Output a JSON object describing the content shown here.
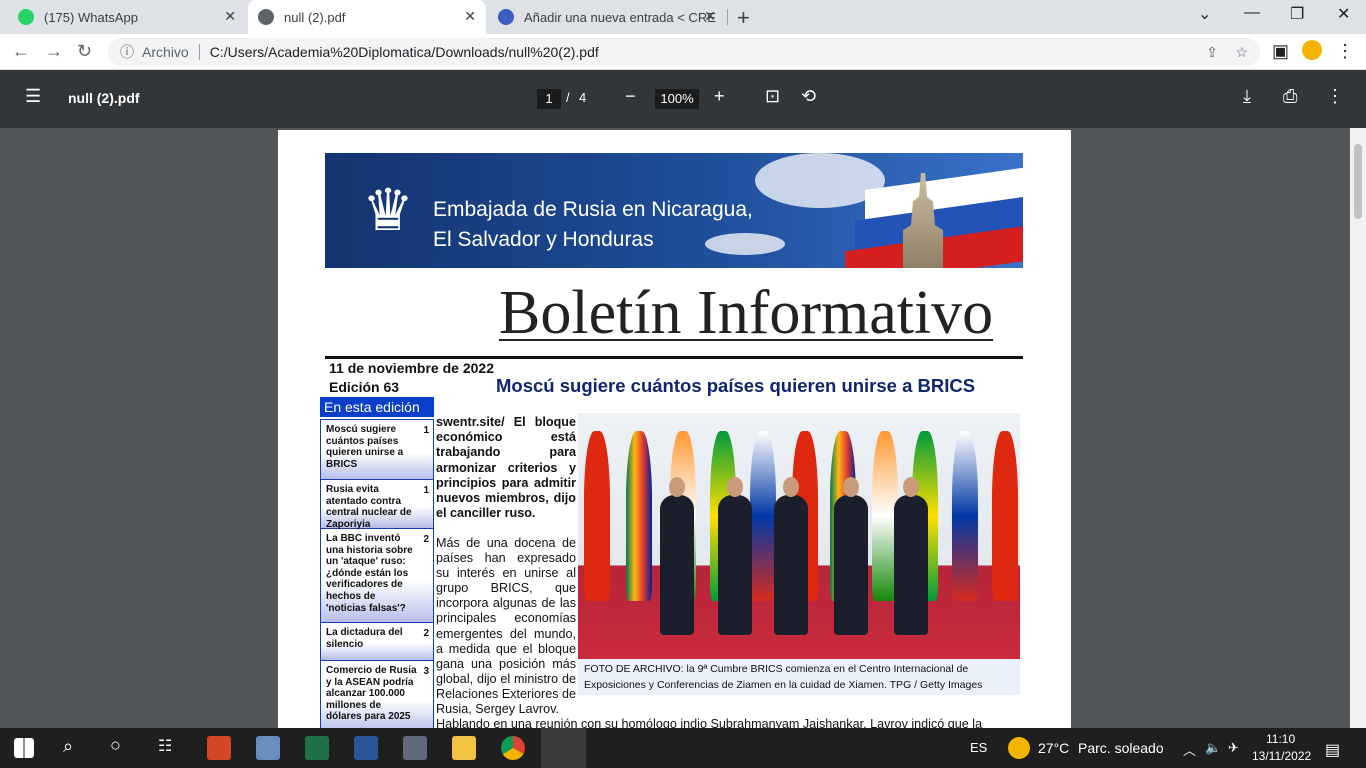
{
  "browser": {
    "tabs": [
      {
        "title": "(175) WhatsApp"
      },
      {
        "title": "null (2).pdf"
      },
      {
        "title": "Añadir una nueva entrada < CRE"
      }
    ],
    "address_chip": "Archivo",
    "url": "C:/Users/Academia%20Diplomatica/Downloads/null%20(2).pdf"
  },
  "viewer": {
    "filename": "null (2).pdf",
    "current_page": "1",
    "page_sep": "/",
    "total_pages": "4",
    "zoom": "100%"
  },
  "bulletin": {
    "banner_line1": "Embajada de Rusia en Nicaragua,",
    "banner_line2": "El Salvador y Honduras",
    "title": "Boletín Informativo",
    "date": "11 de noviembre de 2022",
    "edition": "Edición  63",
    "headline": "Moscú sugiere cuántos países quieren unirse a BRICS",
    "toc_header": "En esta edición",
    "toc": [
      {
        "text": "Moscú sugiere cuántos países quieren unirse a BRICS",
        "page": "1"
      },
      {
        "text": "Rusia evita atentado contra central nuclear de Zaporiyia",
        "page": "1"
      },
      {
        "text": "La BBC inventó una historia sobre un 'ataque' ruso: ¿dónde están los verificadores de hechos de 'noticias falsas'?",
        "page": "2"
      },
      {
        "text": "La dictadura del silencio",
        "page": "2"
      },
      {
        "text": "Comercio de Rusia y la  ASEAN podría alcanzar 100.000 millones de dólares para 2025",
        "page": "3"
      }
    ],
    "lead": "swentr.site/ El bloque económico está trabajando para armonizar criterios y principios para admitir nuevos miembros, dijo el canciller ruso.",
    "body": "Más de una docena de países han expresado su interés en unirse al grupo BRICS, que incorpora algunas de las principales economías emergentes del mundo, a medida que el bloque gana una posición más global, dijo el ministro de Relaciones Exteriores de Rusia, Sergey Lavrov.",
    "continuation": "Hablando en una reunión con su homólogo indio Subrahmanyam Jaishankar, Lavrov indicó que la",
    "caption": "FOTO DE ARCHIVO: la 9ª Cumbre BRICS comienza en el Centro Internacional de Exposiciones y Conferencias de Ziamen en la cuidad de Xiamen. TPG / Getty Images"
  },
  "taskbar": {
    "lang": "ES",
    "temperature": "27°C",
    "weather": "Parc. soleado",
    "time": "11:10",
    "date": "13/11/2022"
  },
  "icons": [
    "menu-icon",
    "download-icon",
    "print-icon",
    "more-icon",
    "fit-page-icon",
    "rotate-icon",
    "zoom-out-icon",
    "zoom-in-icon",
    "back-icon",
    "forward-icon",
    "reload-icon",
    "info-icon",
    "share-icon",
    "star-icon",
    "sidebar-icon",
    "profile-icon",
    "windows-start-icon",
    "search-icon",
    "cortana-icon",
    "task-view-icon"
  ],
  "colors": {
    "toc_header": "#0a3fcc",
    "headline": "#10266c",
    "pdf_toolbar": "#323639",
    "viewer_bg": "#525659"
  }
}
